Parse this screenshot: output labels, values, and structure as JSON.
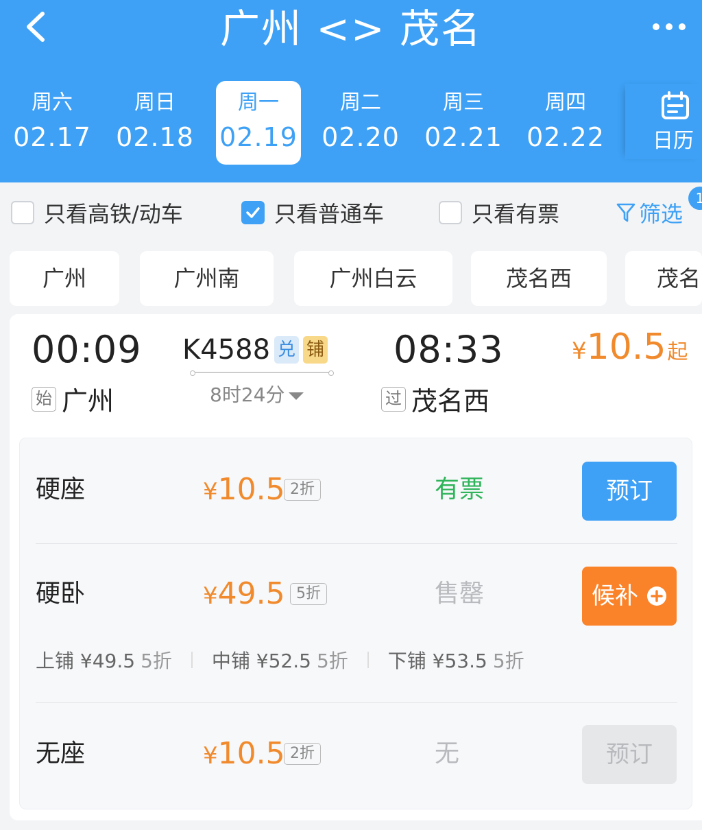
{
  "header": {
    "title": "广州 <> 茂名",
    "date_tabs": [
      {
        "weekday": "周六",
        "date": "02.17"
      },
      {
        "weekday": "周日",
        "date": "02.18"
      },
      {
        "weekday": "周一",
        "date": "02.19"
      },
      {
        "weekday": "周二",
        "date": "02.20"
      },
      {
        "weekday": "周三",
        "date": "02.21"
      },
      {
        "weekday": "周四",
        "date": "02.22"
      }
    ],
    "selected_index": 2,
    "calendar_label": "日历"
  },
  "filters": {
    "gaotie": {
      "label": "只看高铁/动车",
      "checked": false
    },
    "putong": {
      "label": "只看普通车",
      "checked": true
    },
    "youpiao": {
      "label": "只看有票",
      "checked": false
    },
    "filter_label": "筛选",
    "filter_badge": "1"
  },
  "stations": [
    "广州",
    "广州南",
    "广州白云",
    "茂名西",
    "茂名"
  ],
  "train": {
    "dep_time": "00:09",
    "arr_time": "08:33",
    "number": "K4588",
    "tag_exchange": "兑",
    "tag_berth": "铺",
    "duration": "8时24分",
    "dep_mark": "始",
    "dep_station": "广州",
    "arr_mark": "过",
    "arr_station": "茂名西",
    "min_price_currency": "¥",
    "min_price": "10.5",
    "min_price_suffix": "起"
  },
  "seats": [
    {
      "name": "硬座",
      "currency": "¥",
      "price": "10.5",
      "discount": "2折",
      "status": "有票",
      "action": "预订"
    },
    {
      "name": "硬卧",
      "currency": "¥",
      "price": "49.5",
      "discount": "5折",
      "status": "售罄",
      "action": "候补"
    },
    {
      "name": "无座",
      "currency": "¥",
      "price": "10.5",
      "discount": "2折",
      "status": "无",
      "action": "预订"
    }
  ],
  "berths": [
    {
      "label": "上铺 ¥49.5",
      "discount": "5折"
    },
    {
      "label": "中铺 ¥52.5",
      "discount": "5折"
    },
    {
      "label": "下铺 ¥53.5",
      "discount": "5折"
    }
  ],
  "colors": {
    "accent": "#3ea1f5",
    "price": "#f08a2c",
    "available": "#2fb45a",
    "waitlist": "#fa8329",
    "disabled": "#b8babd"
  },
  "icons": [
    "back-arrow-icon",
    "more-icon",
    "calendar-icon",
    "checkbox-icon",
    "filter-icon",
    "chevron-down-icon",
    "plus-circle-icon"
  ]
}
